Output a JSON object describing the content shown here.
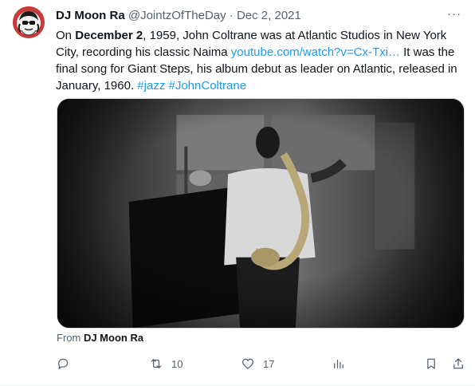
{
  "tweet": {
    "author_name": "DJ Moon Ra",
    "handle": "@JointzOfTheDay",
    "separator": " · ",
    "date": "Dec 2, 2021",
    "more_label": "···",
    "text_parts": {
      "p1": "On ",
      "bold1": "December 2",
      "p2": ", 1959, John Coltrane was at Atlantic Studios in New York City, recording his classic Naima ",
      "link": "youtube.com/watch?v=Cx-Txi…",
      "p3": " It was the final song for Giant Steps, his album debut as leader on Atlantic, released in January, 1960. ",
      "hashtag1": "#jazz",
      "space": " ",
      "hashtag2": "#JohnColtrane"
    },
    "from_prefix": "From ",
    "from_name": "DJ Moon Ra",
    "retweet_count": "10",
    "like_count": "17",
    "colors": {
      "link": "#1d9bf0",
      "muted": "#536471",
      "text": "#0f1419",
      "avatar_ring": "#c83a3a"
    },
    "icons": [
      "reply-icon",
      "retweet-icon",
      "like-icon",
      "views-icon",
      "bookmark-icon",
      "share-icon",
      "more-icon"
    ]
  }
}
